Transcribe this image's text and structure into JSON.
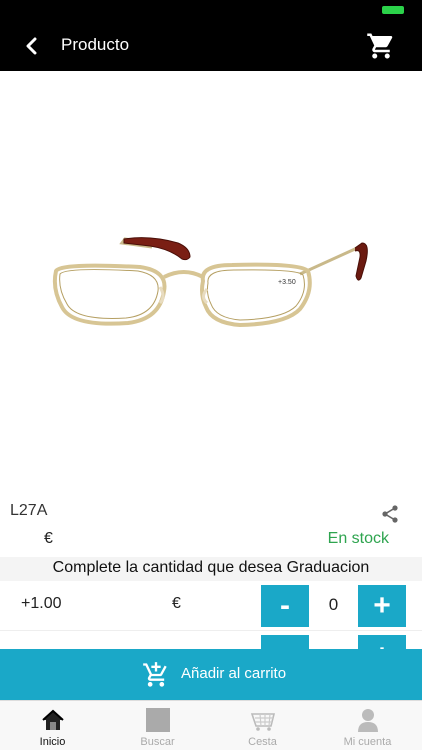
{
  "nav": {
    "title": "Producto"
  },
  "product": {
    "sku": "L27A",
    "price": "€",
    "stock": "En stock",
    "lens_label": "+3.50"
  },
  "graduation": {
    "header": "Complete la cantidad que desea Graduacion",
    "rows": [
      {
        "grad": "+1.00",
        "price": "€",
        "qty": "0",
        "minus": "-",
        "plus": "+"
      },
      {
        "grad": "",
        "price": "",
        "qty": "",
        "minus": "-",
        "plus": "+"
      }
    ]
  },
  "add_to_cart": {
    "label": "Añadir al carrito"
  },
  "tabs": [
    {
      "label": "Inicio",
      "icon": "home-icon",
      "active": true
    },
    {
      "label": "Buscar",
      "icon": "search-icon",
      "active": false
    },
    {
      "label": "Cesta",
      "icon": "basket-icon",
      "active": false
    },
    {
      "label": "Mi cuenta",
      "icon": "account-icon",
      "active": false
    }
  ],
  "colors": {
    "accent": "#1aa8c8",
    "stock": "#2ea44f",
    "header": "#000000"
  }
}
